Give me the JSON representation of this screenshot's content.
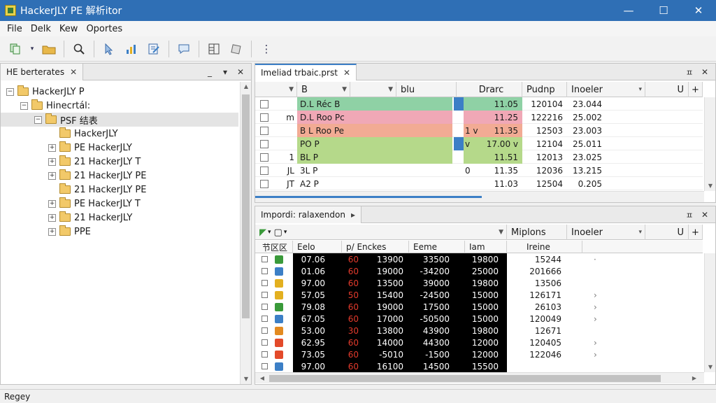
{
  "window": {
    "title": "HackerJLY PE 解析itor",
    "controls": {
      "minimize": "—",
      "maximize": "☐",
      "close": "✕"
    }
  },
  "menu": [
    "File",
    "Delk",
    "Kew",
    "Oportes"
  ],
  "toolbar": {
    "icons": [
      "copy-icon",
      "folder-icon",
      "search-icon",
      "pointer-icon",
      "chart-icon",
      "edit-icon",
      "comment-icon",
      "layout-icon",
      "puzzle-icon",
      "more-icon"
    ]
  },
  "left_panel": {
    "tab_label": "HE berterates",
    "controls": {
      "minimize": "_",
      "menu": "▾",
      "close": "✕"
    },
    "tree": [
      {
        "label": "HackerJLY P",
        "toggle": "−",
        "indent": 0
      },
      {
        "label": "Hinecrtál:",
        "toggle": "−",
        "indent": 1
      },
      {
        "label": "PSF 结表",
        "toggle": "−",
        "indent": 2,
        "selected": true
      },
      {
        "label": "HackerJLY",
        "toggle": "",
        "indent": 3
      },
      {
        "label": "PE HackerJLY",
        "toggle": "+",
        "indent": 3
      },
      {
        "label": "21 HackerJLY T",
        "toggle": "+",
        "indent": 3
      },
      {
        "label": "21 HackerJLY PE",
        "toggle": "+",
        "indent": 3
      },
      {
        "label": "21 HackerJLY PE",
        "toggle": "",
        "indent": 3
      },
      {
        "label": "PE HackerJLY T",
        "toggle": "+",
        "indent": 3
      },
      {
        "label": "21 HackerJLY",
        "toggle": "+",
        "indent": 3
      },
      {
        "label": "PPE",
        "toggle": "+",
        "indent": 3
      }
    ]
  },
  "top_panel": {
    "tab_label": "Imeliad trbaic.prst",
    "controls": {
      "pin": "ㅍ",
      "close": "✕"
    },
    "columns": [
      "B",
      "blu",
      "Drarc",
      "Pudnp",
      "Inoeler",
      "U"
    ],
    "rows": [
      {
        "mark": "",
        "name": "D.L Réc B",
        "flag": "",
        "v1": "11.05",
        "v2": "120104",
        "v3": "23.044",
        "color": "#8fd1a5",
        "blue": true
      },
      {
        "mark": "m",
        "name": "D.L Roo Pc",
        "flag": "",
        "v1": "11.25",
        "v2": "122216",
        "v3": "25.002",
        "color": "#f0a8b6",
        "blue": false
      },
      {
        "mark": "",
        "name": "B L Roo Pe",
        "flag": "1 v",
        "v1": "11.35",
        "v2": "12503",
        "v3": "23.003",
        "color": "#f2ab94",
        "blue": false
      },
      {
        "mark": "",
        "name": "PO P",
        "flag": "v",
        "v1": "17.00 v",
        "v2": "12104",
        "v3": "25.011",
        "color": "#b5d98a",
        "blue": true
      },
      {
        "mark": "1",
        "name": "BL P",
        "flag": "",
        "v1": "11.51",
        "v2": "12013",
        "v3": "23.025",
        "color": "#b5d98a",
        "blue": false
      },
      {
        "mark": "JL",
        "name": "3L P",
        "flag": "0",
        "v1": "11.35",
        "v2": "12036",
        "v3": "13.215",
        "color": "",
        "blue": false
      },
      {
        "mark": "JT",
        "name": "A2 P",
        "flag": "",
        "v1": "11.03",
        "v2": "12504",
        "v3": "0.205",
        "color": "",
        "blue": false
      }
    ]
  },
  "bottom_panel": {
    "tab_label": "Impordi: ralaxendon",
    "tab_arrow": "▸",
    "controls": {
      "pin": "ㅍ",
      "close": "✕"
    },
    "filter_columns": [
      "Miplons",
      "Inoeler"
    ],
    "columns": [
      "节区区",
      "Eelo",
      "p/ Enckes",
      "Eeme",
      "Iam",
      "Ireine"
    ],
    "rows": [
      {
        "a": "07.06",
        "b": "60",
        "c": "13900",
        "d": "33500",
        "e": "19800",
        "f": "15244",
        "g": "·",
        "icon": "#3a9a3a"
      },
      {
        "a": "01.06",
        "b": "60",
        "c": "19000",
        "d": "-34200",
        "e": "25000",
        "f": "201666",
        "g": "",
        "icon": "#3c7fc6"
      },
      {
        "a": "97.00",
        "b": "60",
        "c": "13500",
        "d": "39000",
        "e": "19800",
        "f": "13506",
        "g": "",
        "icon": "#e3b020"
      },
      {
        "a": "57.05",
        "b": "50",
        "c": "15400",
        "d": "-24500",
        "e": "15000",
        "f": "126171",
        "g": "›",
        "icon": "#e3b020"
      },
      {
        "a": "79.08",
        "b": "60",
        "c": "19000",
        "d": "17500",
        "e": "15000",
        "f": "26103",
        "g": "›",
        "icon": "#3a9a3a"
      },
      {
        "a": "67.05",
        "b": "60",
        "c": "17000",
        "d": "-50500",
        "e": "15000",
        "f": "120049",
        "g": "›",
        "icon": "#3c7fc6"
      },
      {
        "a": "53.00",
        "b": "30",
        "c": "13800",
        "d": "43900",
        "e": "19800",
        "f": "12671",
        "g": "",
        "icon": "#e38a20"
      },
      {
        "a": "62.95",
        "b": "60",
        "c": "14000",
        "d": "44300",
        "e": "12000",
        "f": "120405",
        "g": "›",
        "icon": "#e34a2a"
      },
      {
        "a": "73.05",
        "b": "60",
        "c": "-5010",
        "d": "-1500",
        "e": "12000",
        "f": "122046",
        "g": "›",
        "icon": "#e34a2a"
      },
      {
        "a": "97.00",
        "b": "60",
        "c": "16100",
        "d": "14500",
        "e": "15500",
        "f": "",
        "g": "",
        "icon": "#3c7fc6"
      }
    ]
  },
  "status": "Regey"
}
